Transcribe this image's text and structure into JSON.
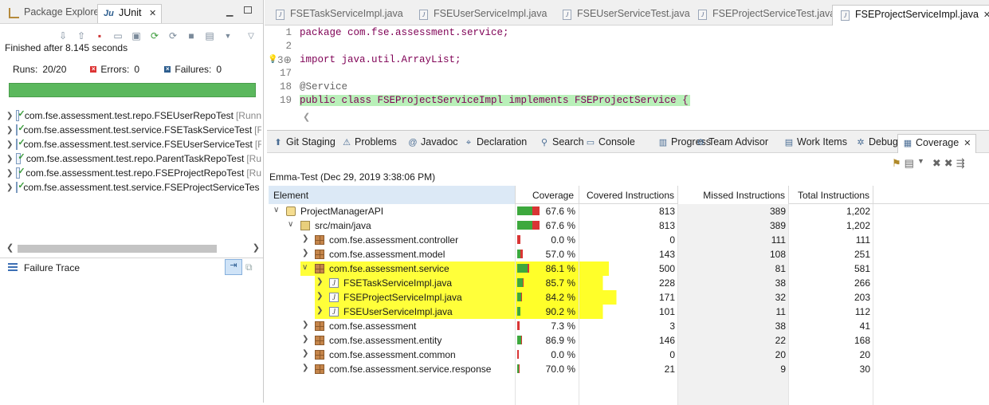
{
  "left_panel": {
    "tabs": [
      {
        "label": "Package Explorer",
        "active": false
      },
      {
        "label": "JUnit",
        "active": true
      }
    ],
    "status": "Finished after 8.145 seconds",
    "runs_label": "Runs:",
    "runs_value": "20/20",
    "errors_label": "Errors:",
    "errors_value": "0",
    "failures_label": "Failures:",
    "failures_value": "0",
    "progress": 1.0,
    "progress_color": "#5bb85d",
    "tests": [
      {
        "name": "com.fse.assessment.test.repo.FSEUserRepoTest",
        "suffix": "[Runn"
      },
      {
        "name": "com.fse.assessment.test.service.FSETaskServiceTest",
        "suffix": "[F"
      },
      {
        "name": "com.fse.assessment.test.service.FSEUserServiceTest",
        "suffix": "[F"
      },
      {
        "name": "com.fse.assessment.test.repo.ParentTaskRepoTest",
        "suffix": "[Ru"
      },
      {
        "name": "com.fse.assessment.test.repo.FSEProjectRepoTest",
        "suffix": "[Ru"
      },
      {
        "name": "com.fse.assessment.test.service.FSEProjectServiceTes",
        "suffix": ""
      }
    ],
    "failure_trace_title": "Failure Trace"
  },
  "editor": {
    "tabs": [
      {
        "label": "FSETaskServiceImpl.java",
        "active": false
      },
      {
        "label": "FSEUserServiceImpl.java",
        "active": false
      },
      {
        "label": "FSEUserServiceTest.java",
        "active": false
      },
      {
        "label": "FSEProjectServiceTest.java",
        "active": false
      },
      {
        "label": "FSEProjectServiceImpl.java",
        "active": true
      }
    ],
    "lines": [
      {
        "num": "1",
        "text": "package com.fse.assessment.service;"
      },
      {
        "num": "2",
        "text": ""
      },
      {
        "num": "3⊕",
        "text": "import java.util.ArrayList;"
      },
      {
        "num": "17",
        "text": ""
      },
      {
        "num": "18",
        "text": "@Service"
      },
      {
        "num": "19",
        "text": "public class FSEProjectServiceImpl implements FSEProjectService {"
      }
    ]
  },
  "views": {
    "tabs": [
      {
        "label": "Git Staging",
        "icon": "git-icon"
      },
      {
        "label": "Problems",
        "icon": "problems-icon"
      },
      {
        "label": "Javadoc",
        "icon": "javadoc-icon"
      },
      {
        "label": "Declaration",
        "icon": "declaration-icon"
      },
      {
        "label": "Search",
        "icon": "search-icon"
      },
      {
        "label": "Console",
        "icon": "console-icon"
      },
      {
        "label": "Progress",
        "icon": "progress-icon"
      },
      {
        "label": "Team Advisor",
        "icon": "team-advisor-icon"
      },
      {
        "label": "Work Items",
        "icon": "work-items-icon"
      },
      {
        "label": "Debug",
        "icon": "debug-icon"
      },
      {
        "label": "Coverage",
        "icon": "coverage-icon",
        "active": true
      }
    ],
    "session": "Emma-Test (Dec 29, 2019 3:38:06 PM)",
    "columns": [
      "Element",
      "Coverage",
      "Covered Instructions",
      "Missed Instructions",
      "Total Instructions"
    ],
    "rows": [
      {
        "element": "ProjectManagerAPI",
        "type": "project",
        "level": 0,
        "expanded": true,
        "coverage": "67.6 %",
        "cov": 0.676,
        "covered": "813",
        "missed": "389",
        "total": "1,202",
        "highlight": false
      },
      {
        "element": "src/main/java",
        "type": "source",
        "level": 1,
        "expanded": true,
        "coverage": "67.6 %",
        "cov": 0.676,
        "covered": "813",
        "missed": "389",
        "total": "1,202",
        "highlight": false
      },
      {
        "element": "com.fse.assessment.controller",
        "type": "package",
        "level": 2,
        "expanded": false,
        "coverage": "0.0 %",
        "cov": 0.0,
        "covered": "0",
        "missed": "111",
        "total": "111",
        "highlight": false
      },
      {
        "element": "com.fse.assessment.model",
        "type": "package",
        "level": 2,
        "expanded": false,
        "coverage": "57.0 %",
        "cov": 0.57,
        "covered": "143",
        "missed": "108",
        "total": "251",
        "highlight": false
      },
      {
        "element": "com.fse.assessment.service",
        "type": "package",
        "level": 2,
        "expanded": true,
        "coverage": "86.1 %",
        "cov": 0.861,
        "covered": "500",
        "missed": "81",
        "total": "581",
        "highlight": true
      },
      {
        "element": "FSETaskServiceImpl.java",
        "type": "java",
        "level": 3,
        "expanded": false,
        "coverage": "85.7 %",
        "cov": 0.857,
        "covered": "228",
        "missed": "38",
        "total": "266",
        "highlight": true
      },
      {
        "element": "FSEProjectServiceImpl.java",
        "type": "java",
        "level": 3,
        "expanded": false,
        "coverage": "84.2 %",
        "cov": 0.842,
        "covered": "171",
        "missed": "32",
        "total": "203",
        "highlight": true
      },
      {
        "element": "FSEUserServiceImpl.java",
        "type": "java",
        "level": 3,
        "expanded": false,
        "coverage": "90.2 %",
        "cov": 0.902,
        "covered": "101",
        "missed": "11",
        "total": "112",
        "highlight": true
      },
      {
        "element": "com.fse.assessment",
        "type": "package",
        "level": 2,
        "expanded": false,
        "coverage": "7.3 %",
        "cov": 0.073,
        "covered": "3",
        "missed": "38",
        "total": "41",
        "highlight": false
      },
      {
        "element": "com.fse.assessment.entity",
        "type": "package",
        "level": 2,
        "expanded": false,
        "coverage": "86.9 %",
        "cov": 0.869,
        "covered": "146",
        "missed": "22",
        "total": "168",
        "highlight": false
      },
      {
        "element": "com.fse.assessment.common",
        "type": "package",
        "level": 2,
        "expanded": false,
        "coverage": "0.0 %",
        "cov": 0.0,
        "covered": "0",
        "missed": "20",
        "total": "20",
        "highlight": false
      },
      {
        "element": "com.fse.assessment.service.response",
        "type": "package",
        "level": 2,
        "expanded": false,
        "coverage": "70.0 %",
        "cov": 0.7,
        "covered": "21",
        "missed": "9",
        "total": "30",
        "highlight": false
      }
    ],
    "colors": {
      "covered": "#3da83d",
      "missed": "#d93535",
      "highlight": "#ffff29"
    }
  }
}
